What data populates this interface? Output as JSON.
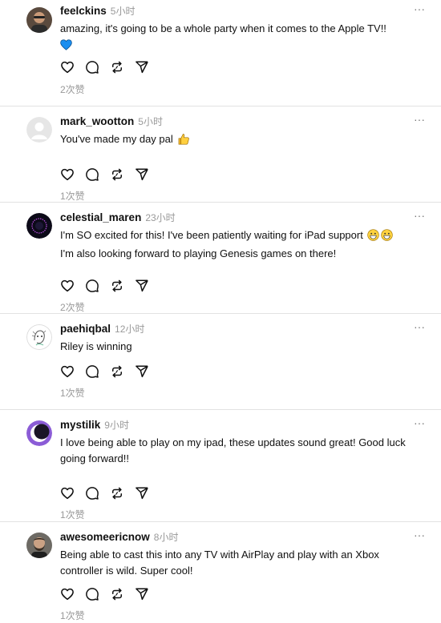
{
  "posts": [
    {
      "username": "feelckins",
      "time": "5小时",
      "text": "amazing, it's going to be a whole party when it comes to the Apple TV!!",
      "likes": "2次赞",
      "avatar": "man-with-glasses-avatar",
      "emoji": "blue-heart"
    },
    {
      "username": "mark_wootton",
      "time": "5小时",
      "text": "You've made my day pal",
      "likes": "1次赞",
      "avatar": "default-gray-avatar",
      "emoji": "thumbs-up"
    },
    {
      "username": "celestial_maren",
      "time": "23小时",
      "text": "I'm SO excited for this! I've been patiently waiting for iPad support",
      "text2": "I'm also looking forward to playing Genesis games on there!",
      "likes": "2次赞",
      "avatar": "dark-circle-avatar",
      "emoji": "grinning-faces"
    },
    {
      "username": "paehiqbal",
      "time": "12小时",
      "text": "Riley is winning",
      "likes": "1次赞",
      "avatar": "sketch-character-avatar"
    },
    {
      "username": "mystilik",
      "time": "9小时",
      "text": "I love being able to play on my ipad, these updates sound great! Good luck going forward!!",
      "likes": "1次赞",
      "avatar": "purple-moon-avatar"
    },
    {
      "username": "awesomeericnow",
      "time": "8小时",
      "text": "Being able to cast this into any TV with AirPlay and play with an Xbox controller is wild. Super cool!",
      "likes": "1次赞",
      "avatar": "bearded-man-avatar"
    }
  ],
  "more_label": "···",
  "icons": [
    "heart-icon",
    "comment-icon",
    "repost-icon",
    "share-icon"
  ],
  "colors": {
    "text": "#101010",
    "secondary": "#999999",
    "divider": "#e2e2e2",
    "blue_heart": "#1c8ff0"
  }
}
